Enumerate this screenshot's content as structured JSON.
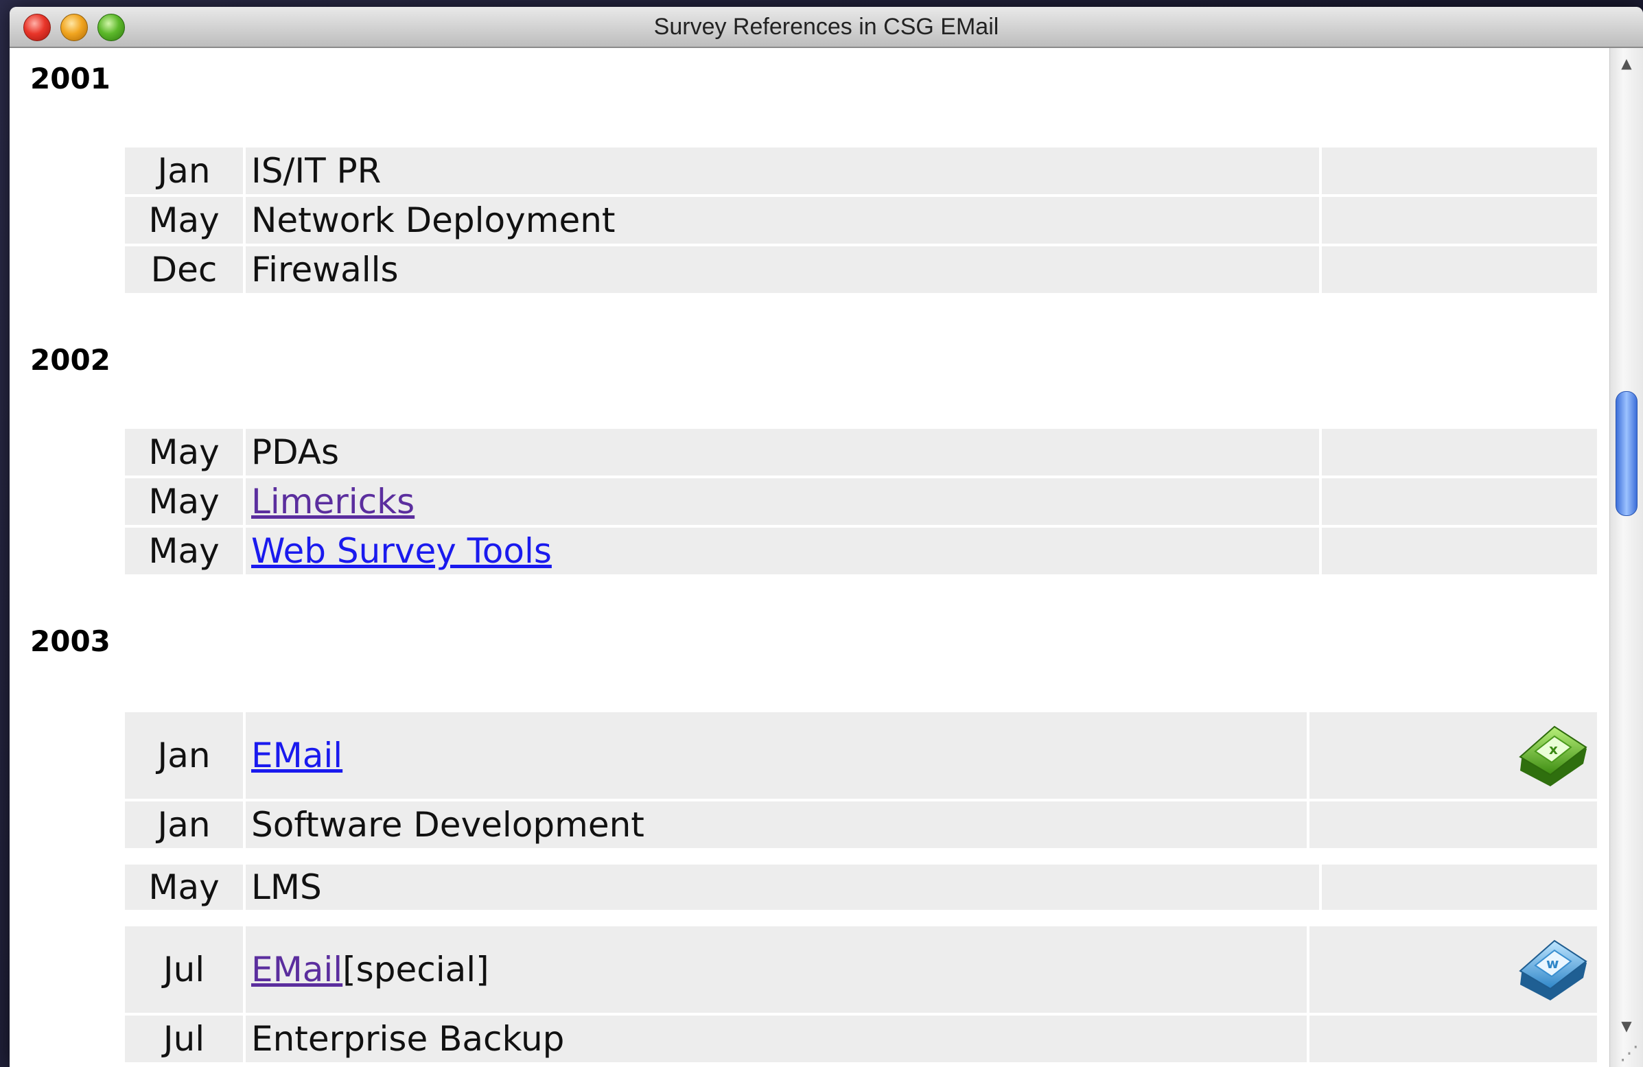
{
  "window": {
    "title": "Survey References in CSG EMail"
  },
  "sections": [
    {
      "year": "2001",
      "rows": [
        {
          "month": "Jan",
          "topic": "IS/IT PR"
        },
        {
          "month": "May",
          "topic": "Network Deployment"
        },
        {
          "month": "Dec",
          "topic": "Firewalls"
        }
      ]
    },
    {
      "year": "2002",
      "rows": [
        {
          "month": "May",
          "topic": "PDAs"
        },
        {
          "month": "May",
          "topic": "Limericks",
          "link": "visited"
        },
        {
          "month": "May",
          "topic": "Web Survey Tools",
          "link": "unvisited"
        }
      ]
    },
    {
      "year": "2003",
      "rows": [
        {
          "month": "Jan",
          "topic": "EMail",
          "link": "unvisited",
          "icon": "excel-icon"
        },
        {
          "month": "Jan",
          "topic": "Software Development"
        },
        {
          "month": "May",
          "topic": "LMS"
        },
        {
          "month": "Jul",
          "topic": "EMail",
          "suffix": " [special]",
          "link": "visited",
          "icon": "word-icon"
        },
        {
          "month": "Jul",
          "topic": "Enterprise Backup"
        }
      ]
    }
  ],
  "scrollbar": {
    "up_arrow": "▲",
    "down_arrow": "▼"
  },
  "colors": {
    "link_unvisited": "#1a1aee",
    "link_visited": "#5b2e9e",
    "row_background": "#ededed"
  }
}
